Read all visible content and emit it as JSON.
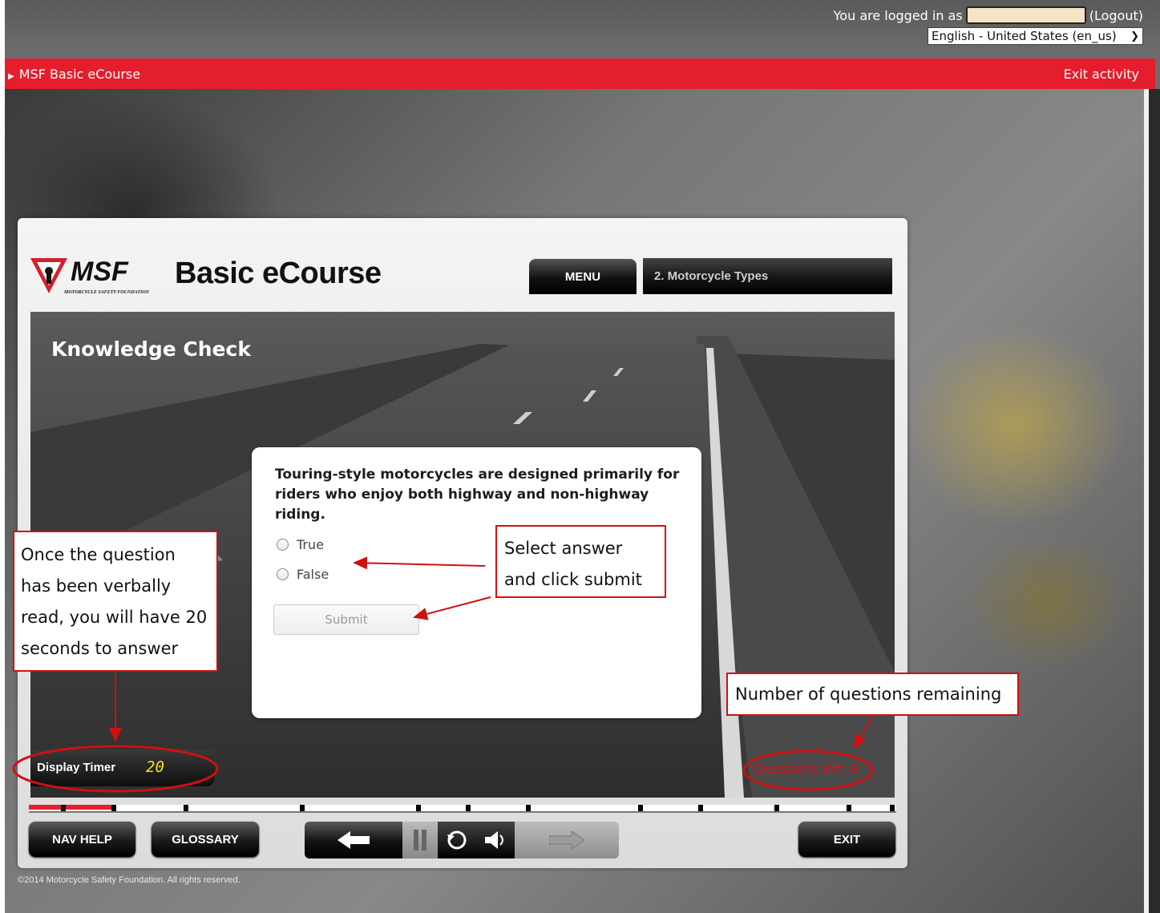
{
  "header": {
    "logged_in_prefix": "You are logged in as",
    "logout_label": "(Logout)",
    "language": "English - United States (en_us)"
  },
  "course_bar": {
    "course_name": "MSF Basic eCourse",
    "exit_label": "Exit activity"
  },
  "course_player": {
    "logo_text": "MSF",
    "logo_subtext": "MOTORCYCLE SAFETY FOUNDATION",
    "title": "Basic eCourse",
    "menu_label": "MENU",
    "module_title": "2. Motorcycle Types",
    "section_title": "Knowledge Check",
    "question": {
      "text": "Touring-style motorcycles are designed primarily for riders who enjoy both highway and non-highway riding.",
      "options": [
        "True",
        "False"
      ],
      "submit_label": "Submit"
    },
    "timer": {
      "label": "Display Timer",
      "value": "20"
    },
    "questions_left": "Questions left: 8",
    "progress_fraction": 0.1,
    "buttons": {
      "nav_help": "NAV HELP",
      "glossary": "GLOSSARY",
      "exit": "EXIT"
    },
    "copyright": "©2014 Motorcycle Safety Foundation. All rights reserved."
  },
  "annotations": {
    "timer_note": "Once the question has been verbally read, you will have 20 seconds to answer",
    "answer_note": "Select answer and click submit",
    "remaining_note": "Number of questions remaining"
  },
  "colors": {
    "brand_red": "#e41e2d",
    "annotation_red": "#d01010",
    "timer_yellow": "#f3e321"
  }
}
